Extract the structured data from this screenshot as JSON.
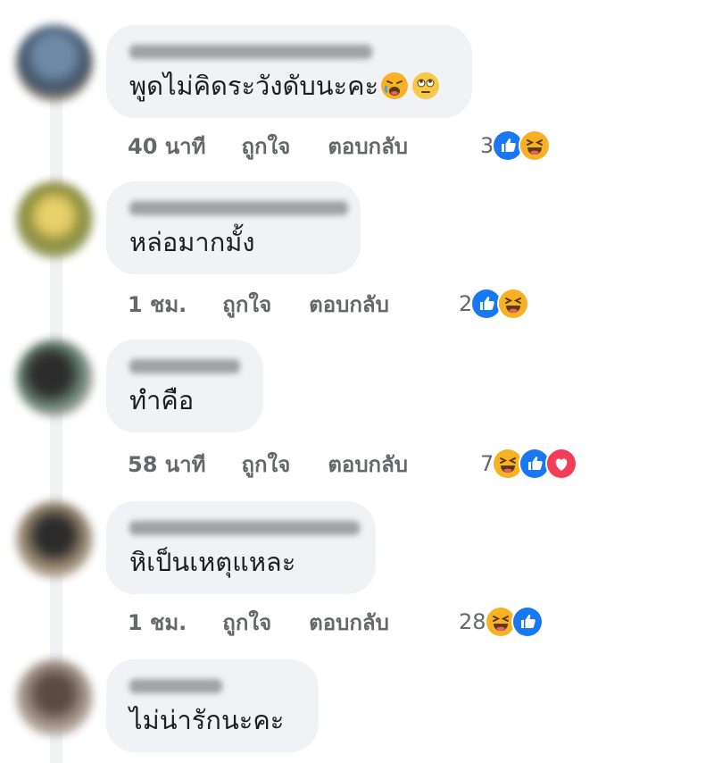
{
  "comments": [
    {
      "text": "พูดไม่คิดระวังดับนะคะ",
      "time": "40 นาที",
      "like_label": "ถูกใจ",
      "reply_label": "ตอบกลับ",
      "reaction_count": "3",
      "reactions": [
        "like-icon",
        "haha-icon"
      ],
      "inline_emojis": [
        "tired-face-emoji",
        "eye-roll-emoji"
      ]
    },
    {
      "text": "หล่อมากมั้ง",
      "time": "1 ชม.",
      "like_label": "ถูกใจ",
      "reply_label": "ตอบกลับ",
      "reaction_count": "2",
      "reactions": [
        "like-icon",
        "haha-icon"
      ]
    },
    {
      "text": "ทำคือ",
      "time": "58 นาที",
      "like_label": "ถูกใจ",
      "reply_label": "ตอบกลับ",
      "reaction_count": "7",
      "reactions": [
        "haha-icon",
        "like-icon",
        "love-icon"
      ]
    },
    {
      "text": "หิเป็นเหตุแหละ",
      "time": "1 ชม.",
      "like_label": "ถูกใจ",
      "reply_label": "ตอบกลับ",
      "reaction_count": "28",
      "reactions": [
        "haha-icon",
        "like-icon"
      ]
    },
    {
      "text": "ไม่น่ารักนะคะ"
    }
  ],
  "colors": {
    "bubble": "#f0f2f5",
    "meta_text": "#65676b",
    "like_blue": "#1877f2",
    "haha_yellow": "#f7b125",
    "love_red": "#f33e58"
  }
}
